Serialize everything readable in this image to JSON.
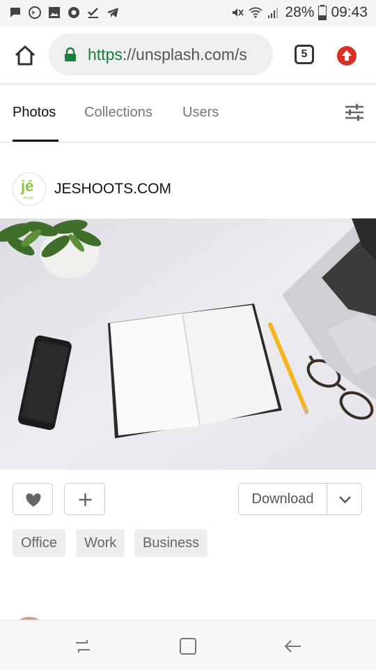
{
  "status_bar": {
    "battery": "28%",
    "time": "09:43"
  },
  "browser": {
    "url_scheme": "https",
    "url_rest": "://unsplash.com/s",
    "tab_count": "5"
  },
  "tabs": [
    "Photos",
    "Collections",
    "Users"
  ],
  "author": {
    "name": "JESHOOTS.COM",
    "avatar_text": "jé",
    "avatar_subtext": "shoots"
  },
  "actions": {
    "download_label": "Download"
  },
  "tags": [
    "Office",
    "Work",
    "Business"
  ],
  "colors": {
    "secure_green": "#188038",
    "update_red": "#d93025",
    "logo_green": "#8bc53f"
  },
  "icons": [
    "message-icon",
    "terminal-icon",
    "image-icon",
    "chrome-icon",
    "check-icon",
    "telegram-icon",
    "mute-icon",
    "wifi-icon",
    "signal-icon",
    "battery-icon",
    "home-icon",
    "lock-icon",
    "tabs-icon",
    "update-icon",
    "filter-icon",
    "heart-icon",
    "plus-icon",
    "chevron-down-icon",
    "recent-apps-icon",
    "home-nav-icon",
    "back-icon"
  ]
}
